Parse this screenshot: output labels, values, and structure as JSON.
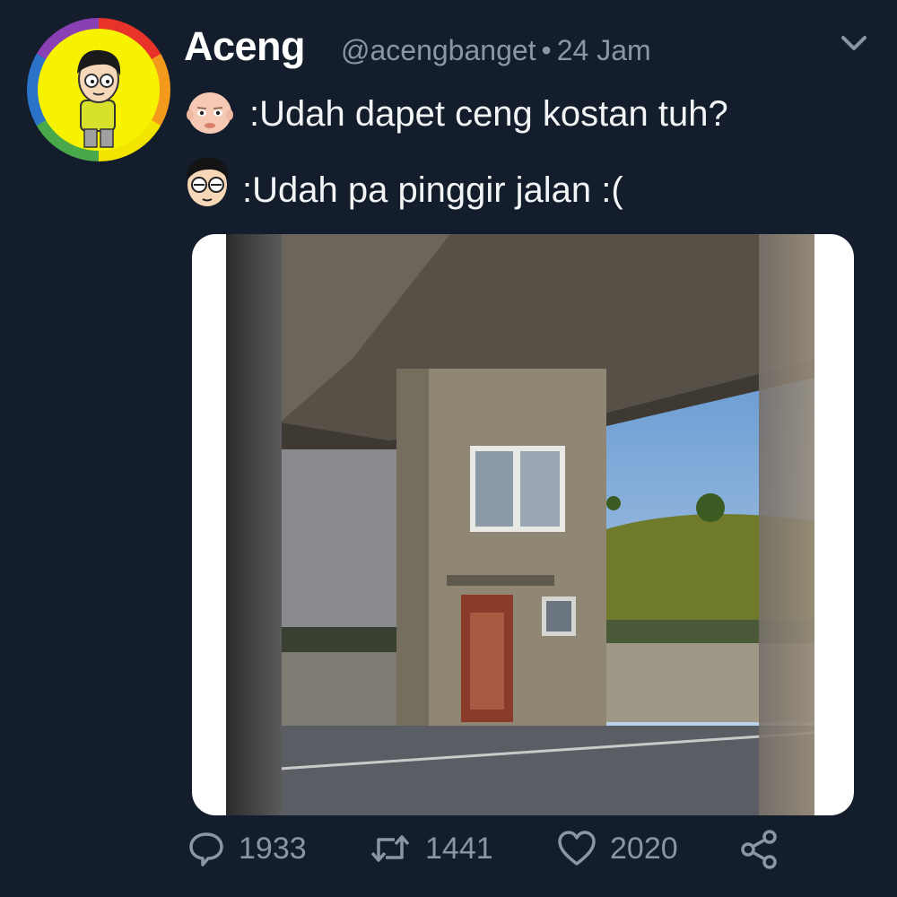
{
  "tweet": {
    "author_name": "Aceng",
    "handle": "@acengbanget",
    "separator": "•",
    "time": "24 Jam",
    "lines": [
      {
        "speaker_icon": "baby-face-emoji",
        "text": ":Udah dapet ceng kostan tuh?"
      },
      {
        "speaker_icon": "cartoon-boy-emoji",
        "text": ":Udah pa pinggir jalan :("
      }
    ],
    "image": {
      "subject": "narrow-house-under-overpass-photo"
    },
    "actions": {
      "replies": "1933",
      "retweets": "1441",
      "likes": "2020"
    }
  },
  "colors": {
    "background": "#141d2b",
    "muted_text": "#8c96a3",
    "text": "#ffffff"
  }
}
